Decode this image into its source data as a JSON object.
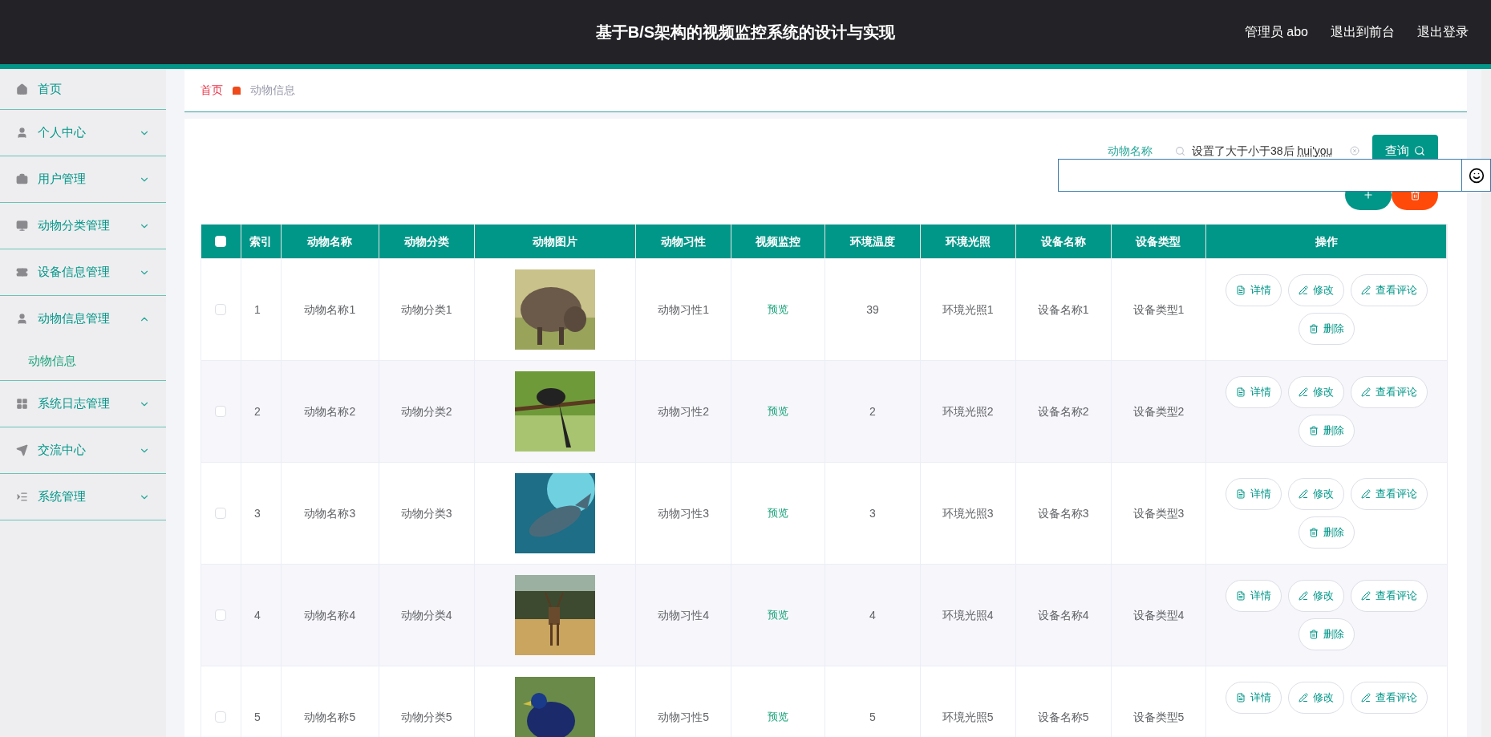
{
  "header": {
    "title": "基于B/S架构的视频监控系统的设计与实现",
    "links": [
      "管理员 abo",
      "退出到前台",
      "退出登录"
    ]
  },
  "sidebar": {
    "items": [
      {
        "label": "首页",
        "expandable": false
      },
      {
        "label": "个人中心",
        "expandable": true,
        "expanded": false
      },
      {
        "label": "用户管理",
        "expandable": true,
        "expanded": false
      },
      {
        "label": "动物分类管理",
        "expandable": true,
        "expanded": false
      },
      {
        "label": "设备信息管理",
        "expandable": true,
        "expanded": false
      },
      {
        "label": "动物信息管理",
        "expandable": true,
        "expanded": true,
        "children": [
          {
            "label": "动物信息",
            "selected": true
          }
        ]
      },
      {
        "label": "系统日志管理",
        "expandable": true,
        "expanded": false
      },
      {
        "label": "交流中心",
        "expandable": true,
        "expanded": false
      },
      {
        "label": "系统管理",
        "expandable": true,
        "expanded": false
      }
    ]
  },
  "breadcrumb": [
    "首页",
    "动物信息"
  ],
  "search": {
    "label": "动物名称",
    "value": "设置了大于小于38后",
    "composition": "hui'you",
    "button": "查询"
  },
  "ime_candidate_box": {
    "visible": true
  },
  "table": {
    "columns": [
      "索引",
      "动物名称",
      "动物分类",
      "动物图片",
      "动物习性",
      "视频监控",
      "环境温度",
      "环境光照",
      "设备名称",
      "设备类型",
      "操作"
    ],
    "header_checked": false,
    "rows": [
      {
        "checked": false,
        "cells": [
          "1",
          "动物名称1",
          "动物分类1",
          "",
          "动物习性1",
          "预览",
          "39",
          "环境光照1",
          "设备名称1",
          "设备类型1"
        ],
        "picture": {
          "kind": "picture"
        },
        "actions": [
          "详情",
          "修改",
          "查看评论",
          "删除"
        ]
      },
      {
        "checked": false,
        "cells": [
          "2",
          "动物名称2",
          "动物分类2",
          "",
          "动物习性2",
          "预览",
          "2",
          "环境光照2",
          "设备名称2",
          "设备类型2"
        ],
        "picture": {
          "kind": "picture"
        },
        "actions": [
          "详情",
          "修改",
          "查看评论",
          "删除"
        ]
      },
      {
        "checked": false,
        "cells": [
          "3",
          "动物名称3",
          "动物分类3",
          "",
          "动物习性3",
          "预览",
          "3",
          "环境光照3",
          "设备名称3",
          "设备类型3"
        ],
        "picture": {
          "kind": "picture"
        },
        "actions": [
          "详情",
          "修改",
          "查看评论",
          "删除"
        ]
      },
      {
        "checked": false,
        "cells": [
          "4",
          "动物名称4",
          "动物分类4",
          "",
          "动物习性4",
          "预览",
          "4",
          "环境光照4",
          "设备名称4",
          "设备类型4"
        ],
        "picture": {
          "kind": "picture"
        },
        "actions": [
          "详情",
          "修改",
          "查看评论",
          "删除"
        ]
      },
      {
        "checked": false,
        "cells": [
          "5",
          "动物名称5",
          "动物分类5",
          "",
          "动物习性5",
          "预览",
          "5",
          "环境光照5",
          "设备名称5",
          "设备类型5"
        ],
        "picture": {
          "kind": "picture"
        },
        "actions": [
          "详情",
          "修改",
          "查看评论"
        ]
      }
    ]
  }
}
